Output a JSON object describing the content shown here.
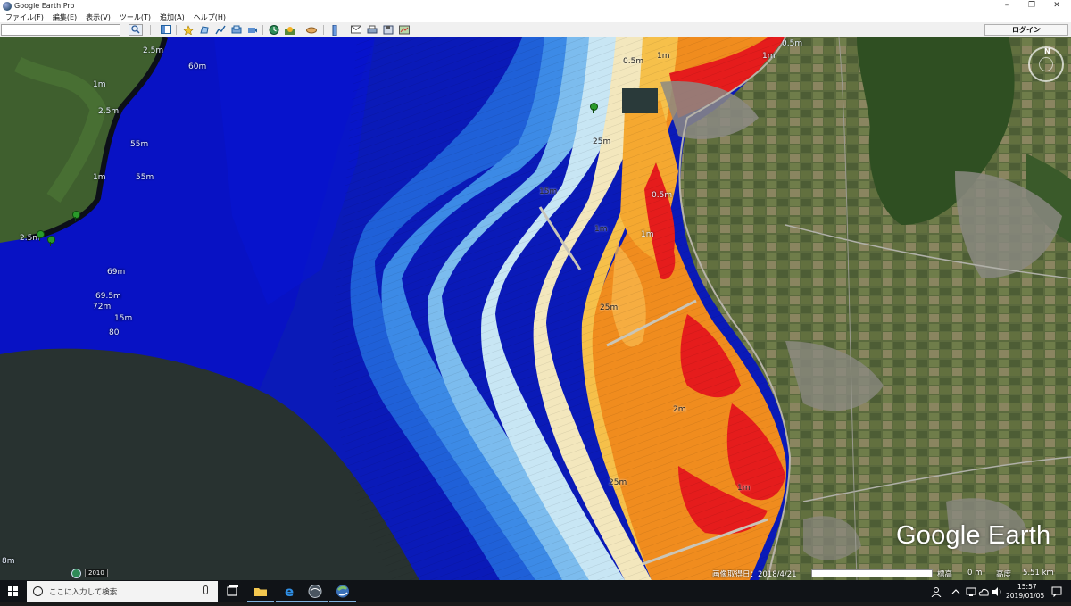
{
  "window": {
    "title": "Google Earth Pro",
    "minimize": "–",
    "maximize": "❐",
    "close": "✕"
  },
  "menu": {
    "items": [
      "ファイル(F)",
      "編集(E)",
      "表示(V)",
      "ツール(T)",
      "追加(A)",
      "ヘルプ(H)"
    ]
  },
  "toolbar": {
    "search_value": "",
    "search_icon": "search-icon",
    "login_label": "ログイン",
    "tools": [
      "sidebar-icon",
      "placemark-icon",
      "polygon-icon",
      "path-icon",
      "overlay-icon",
      "tour-icon",
      "historical-imagery-icon",
      "sunlight-icon",
      "planets-icon",
      "ruler-icon",
      "email-icon",
      "print-icon",
      "save-image-icon",
      "maps-icon"
    ]
  },
  "map": {
    "depth_labels": [
      {
        "text": "60m"
      },
      {
        "text": "2.5m"
      },
      {
        "text": "1m"
      },
      {
        "text": "2.5m"
      },
      {
        "text": "55m"
      },
      {
        "text": "55m"
      },
      {
        "text": "1m"
      },
      {
        "text": "69m"
      },
      {
        "text": "69.5m"
      },
      {
        "text": "72m"
      },
      {
        "text": "15m"
      },
      {
        "text": "80"
      },
      {
        "text": "2.5m"
      },
      {
        "text": "0.5m"
      },
      {
        "text": "1m"
      },
      {
        "text": "0.5m"
      },
      {
        "text": "1m"
      },
      {
        "text": "25m"
      },
      {
        "text": "15m"
      },
      {
        "text": "25m"
      },
      {
        "text": "1m"
      },
      {
        "text": "2m"
      },
      {
        "text": "25m"
      },
      {
        "text": "1m"
      },
      {
        "text": "0.5m"
      },
      {
        "text": "1m"
      },
      {
        "text": "8m"
      }
    ],
    "watermark": "Google Earth",
    "year": "2010",
    "compass_north": "N"
  },
  "status": {
    "imagery_date": "画像取得日：2018/4/21",
    "elevation_label": "標高",
    "elevation_value": "0 m",
    "eye_alt_label": "高度",
    "eye_alt_value": "5.51 km"
  },
  "taskbar": {
    "search_placeholder": "ここに入力して検索",
    "time": "15:57",
    "date": "2019/01/05",
    "apps": [
      "task-view-icon",
      "file-explorer-icon",
      "edge-icon",
      "app-icon",
      "google-earth-icon"
    ]
  }
}
